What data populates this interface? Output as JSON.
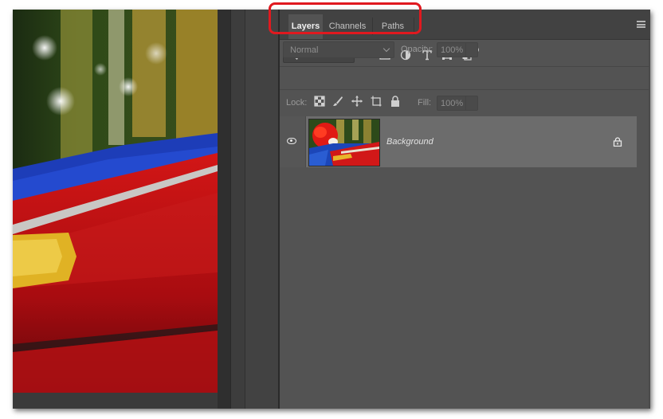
{
  "window": {
    "colors": {
      "panel": "#535353",
      "tabbar": "#424242",
      "highlight": "#e0191f"
    }
  },
  "panel": {
    "tabs": [
      {
        "label": "Layers",
        "active": true
      },
      {
        "label": "Channels",
        "active": false
      },
      {
        "label": "Paths",
        "active": false
      }
    ],
    "menu_icon": "panel-menu-icon"
  },
  "filter": {
    "kind_label": "Kind",
    "icons": [
      "pixel-filter-icon",
      "adjustment-filter-icon",
      "type-filter-icon",
      "shape-filter-icon",
      "smart-object-filter-icon"
    ]
  },
  "blending": {
    "mode": "Normal",
    "opacity_label": "Opacity:",
    "opacity_value": "100%"
  },
  "lock": {
    "label": "Lock:",
    "icons": [
      "lock-transparent-icon",
      "lock-image-icon",
      "lock-position-icon",
      "lock-artboard-icon",
      "lock-all-icon"
    ],
    "fill_label": "Fill:",
    "fill_value": "100%"
  },
  "layers": [
    {
      "name": "Background",
      "visible": true,
      "locked": true
    }
  ]
}
